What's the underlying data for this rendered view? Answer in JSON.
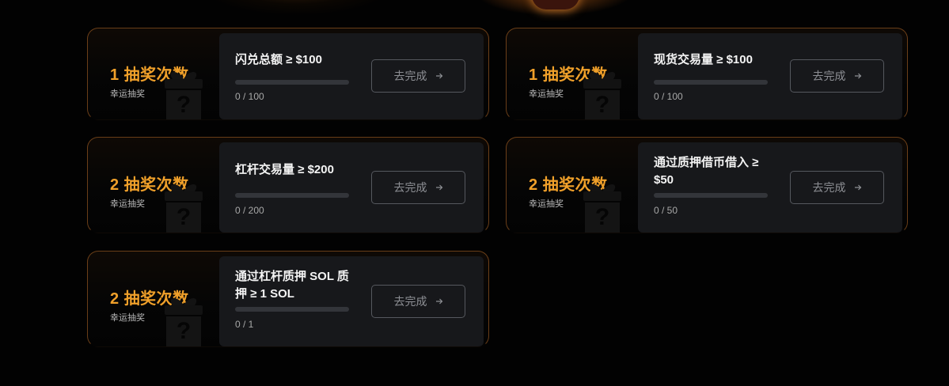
{
  "colors": {
    "accent": "#f0a02a",
    "card_border": "#be6e28",
    "panel_bg": "#17181b",
    "page_bg": "#020202"
  },
  "tasks": [
    {
      "reward_count": "1 抽奖次数",
      "reward_sub": "幸运抽奖",
      "title": "闪兑总额 ≥ $100",
      "progress_text": "0 / 100",
      "progress_fraction": 0,
      "button_label": "去完成",
      "button_icon": "arrow-right-icon",
      "gift_icon": "mystery-gift-icon"
    },
    {
      "reward_count": "1 抽奖次数",
      "reward_sub": "幸运抽奖",
      "title": "现货交易量 ≥ $100",
      "progress_text": "0 / 100",
      "progress_fraction": 0,
      "button_label": "去完成",
      "button_icon": "arrow-right-icon",
      "gift_icon": "mystery-gift-icon"
    },
    {
      "reward_count": "2 抽奖次数",
      "reward_sub": "幸运抽奖",
      "title": "杠杆交易量 ≥ $200",
      "progress_text": "0 / 200",
      "progress_fraction": 0,
      "button_label": "去完成",
      "button_icon": "arrow-right-icon",
      "gift_icon": "mystery-gift-icon"
    },
    {
      "reward_count": "2 抽奖次数",
      "reward_sub": "幸运抽奖",
      "title": "通过质押借币借入 ≥ $50",
      "progress_text": "0 / 50",
      "progress_fraction": 0,
      "button_label": "去完成",
      "button_icon": "arrow-right-icon",
      "gift_icon": "mystery-gift-icon"
    },
    {
      "reward_count": "2 抽奖次数",
      "reward_sub": "幸运抽奖",
      "title": "通过杠杆质押 SOL 质押 ≥ 1 SOL",
      "progress_text": "0 / 1",
      "progress_fraction": 0,
      "button_label": "去完成",
      "button_icon": "arrow-right-icon",
      "gift_icon": "mystery-gift-icon"
    }
  ]
}
